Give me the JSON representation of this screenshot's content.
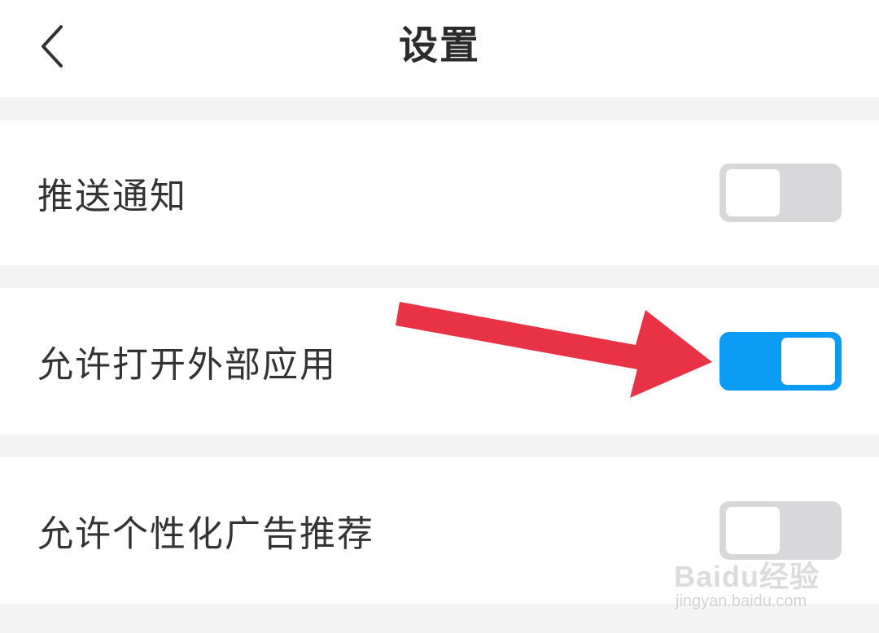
{
  "header": {
    "title": "设置",
    "back_icon": "chevron-left-icon"
  },
  "settings": [
    {
      "label": "推送通知",
      "enabled": false
    },
    {
      "label": "允许打开外部应用",
      "enabled": true
    },
    {
      "label": "允许个性化广告推荐",
      "enabled": false
    }
  ],
  "colors": {
    "toggle_on": "#0a9bf5",
    "toggle_off": "#d8d8da",
    "annotation_arrow": "#e83346"
  },
  "watermark": {
    "brand": "Baidu经验",
    "url": "jingyan.baidu.com"
  }
}
